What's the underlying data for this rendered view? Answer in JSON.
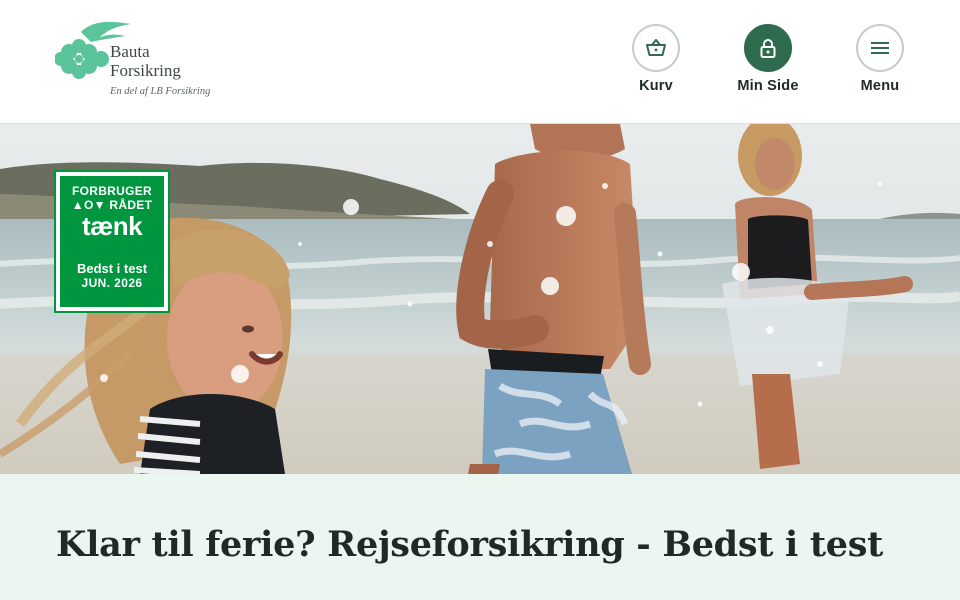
{
  "brand": {
    "name_line1": "Bauta",
    "name_line2": "Forsikring",
    "tagline": "En del af LB Forsikring",
    "color_primary": "#2f6b4e",
    "color_logo": "#5cc49a"
  },
  "nav": {
    "items": [
      {
        "label": "Kurv",
        "icon": "basket-icon"
      },
      {
        "label": "Min Side",
        "icon": "lock-icon"
      },
      {
        "label": "Menu",
        "icon": "hamburger-icon"
      }
    ]
  },
  "badge": {
    "line1": "FORBRUGER",
    "line2": "▲O▼ RÅDET",
    "line3": "tænk",
    "line4": "Bedst i test",
    "line5": "JUN. 2026",
    "color": "#00963f"
  },
  "hero": {
    "image": "family-running-in-ocean-surf"
  },
  "content": {
    "title": "Klar til ferie? Rejseforsikring - Bedst i test",
    "background": "#eaf6ef"
  }
}
